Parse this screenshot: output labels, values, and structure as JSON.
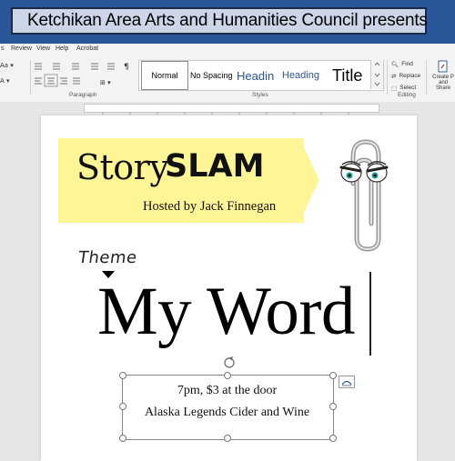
{
  "search": {
    "text": "Ketchikan Area Arts and Humanities Council presents",
    "icon": "search-icon"
  },
  "menu": {
    "items": [
      "s",
      "Review",
      "View",
      "Help",
      "Acrobat"
    ]
  },
  "ribbon": {
    "styles": {
      "normal": "Normal",
      "no_spacing": "No Spacing",
      "heading1": "Headin",
      "heading2": "Heading",
      "title": "Title"
    },
    "groups": {
      "paragraph": "Paragraph",
      "styles": "Styles",
      "editing": "Editing"
    },
    "editing": {
      "find": "Find",
      "replace": "Replace",
      "select": "Select"
    },
    "create_pdf": "Create P",
    "share": "and Share"
  },
  "document": {
    "story": "Story",
    "slam": "SLAM",
    "hosted": "Hosted by Jack Finnegan",
    "theme": "Theme",
    "headline": "My Word",
    "textbox": {
      "line1": "7pm, $3 at the door",
      "line2": "Alaska Legends Cider and Wine"
    }
  },
  "colors": {
    "banner": "#fef597",
    "ribbon": "#2b579a",
    "heading": "#2f5496"
  }
}
